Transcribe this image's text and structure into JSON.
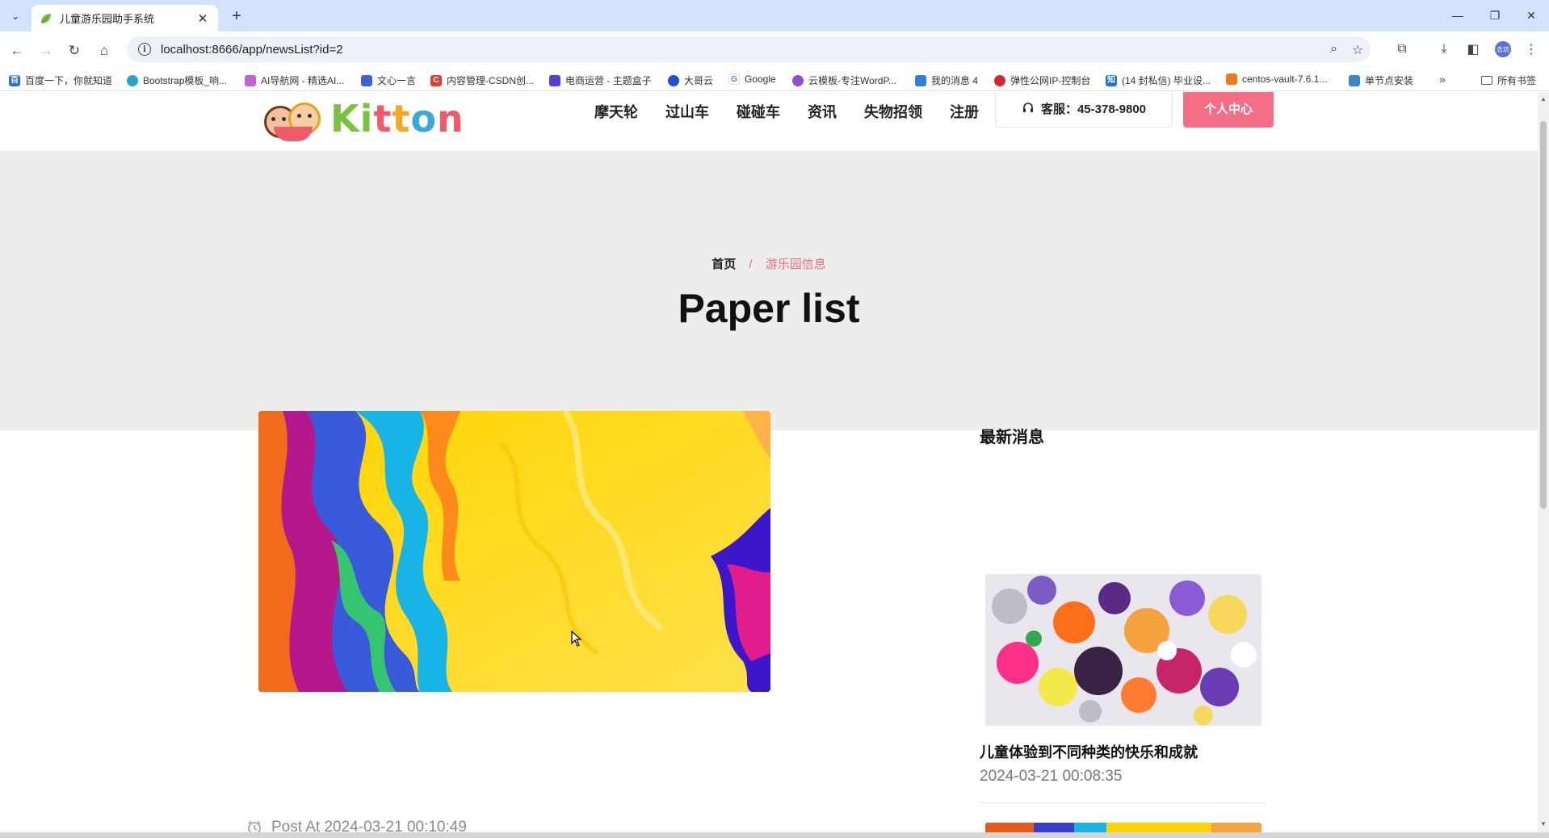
{
  "browser": {
    "tab_title": "儿童游乐园助手系统",
    "url": "localhost:8666/app/newsList?id=2",
    "bookmarks": [
      "百度一下，你就知道",
      "Bootstrap模板_响...",
      "AI导航网 - 精选AI...",
      "文心一言",
      "内容管理-CSDN创...",
      "电商运营 - 主题盒子",
      "大哥云",
      "Google",
      "云模板-专注WordP...",
      "我的消息 4",
      "弹性公网IP-控制台",
      "(14 封私信) 毕业设...",
      "centos-vault-7.6.1...",
      "单节点安装"
    ],
    "bookmarks_folder": "所有书签",
    "profile_label": "去坊"
  },
  "site": {
    "logo_text": "Kitton",
    "nav": [
      "摩天轮",
      "过山车",
      "碰碰车",
      "资讯",
      "失物招领",
      "注册"
    ],
    "hotline": "客服：45-378-9800",
    "user_center": "个人中心"
  },
  "hero": {
    "breadcrumb_home": "首页",
    "breadcrumb_sep": "/",
    "breadcrumb_current": "游乐园信息",
    "title": "Paper list"
  },
  "post": {
    "meta": "Post At 2024-03-21 00:10:49"
  },
  "sidebar": {
    "title": "最新消息",
    "items": [
      {
        "title": "儿童体验到不同种类的快乐和成就",
        "date": "2024-03-21 00:08:35"
      }
    ]
  },
  "colors": {
    "accent": "#f66d86",
    "hero_bg": "#ededed",
    "tabbar_bg": "#d3e3fd"
  }
}
